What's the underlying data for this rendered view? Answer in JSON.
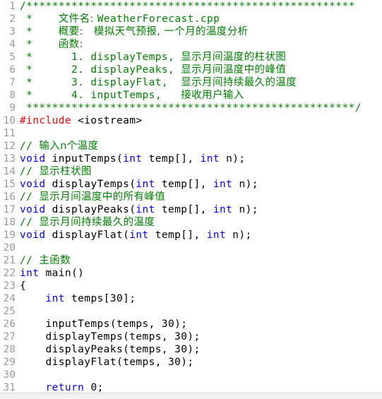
{
  "editor": {
    "name": "code-editor",
    "language": "cpp",
    "first_line": 1,
    "last_line": 31,
    "colors": {
      "background": "#ffffff",
      "gutter_text": "#9a9a9a",
      "comment": "#008000",
      "preprocessor": "#ff0000",
      "keyword": "#0000ff",
      "plain": "#000000",
      "status_strip": "#f0f0f0"
    }
  },
  "lines": [
    {
      "num": "1",
      "tokens": [
        {
          "c": "comment",
          "t": "/***************************************************"
        }
      ]
    },
    {
      "num": "2",
      "tokens": [
        {
          "c": "comment",
          "t": " *    "
        },
        {
          "c": "comment",
          "t": "文件名: ",
          "cjk": true
        },
        {
          "c": "comment",
          "t": "WeatherForecast.cpp"
        }
      ]
    },
    {
      "num": "3",
      "tokens": [
        {
          "c": "comment",
          "t": " *    "
        },
        {
          "c": "comment",
          "t": "概要:   模拟天气预报, 一个月的温度分析",
          "cjk": true
        }
      ]
    },
    {
      "num": "4",
      "tokens": [
        {
          "c": "comment",
          "t": " *    "
        },
        {
          "c": "comment",
          "t": "函数:",
          "cjk": true
        }
      ]
    },
    {
      "num": "5",
      "tokens": [
        {
          "c": "comment",
          "t": " *      1. displayTemps, "
        },
        {
          "c": "comment",
          "t": "显示月间温度的柱状图",
          "cjk": true
        }
      ]
    },
    {
      "num": "6",
      "tokens": [
        {
          "c": "comment",
          "t": " *      2. displayPeaks, "
        },
        {
          "c": "comment",
          "t": "显示月间温度中的峰值",
          "cjk": true
        }
      ]
    },
    {
      "num": "7",
      "tokens": [
        {
          "c": "comment",
          "t": " *      3. displayFlat,  "
        },
        {
          "c": "comment",
          "t": "显示月间持续最久的温度",
          "cjk": true
        }
      ]
    },
    {
      "num": "8",
      "tokens": [
        {
          "c": "comment",
          "t": " *      4. inputTemps,   "
        },
        {
          "c": "comment",
          "t": "接收用户输入",
          "cjk": true
        }
      ]
    },
    {
      "num": "9",
      "tokens": [
        {
          "c": "comment",
          "t": " ***************************************************/"
        }
      ]
    },
    {
      "num": "10",
      "tokens": [
        {
          "c": "pre",
          "t": "#include"
        },
        {
          "c": "plain",
          "t": " <iostream>"
        }
      ]
    },
    {
      "num": "11",
      "tokens": []
    },
    {
      "num": "12",
      "tokens": [
        {
          "c": "comment",
          "t": "// "
        },
        {
          "c": "comment",
          "t": "输入n个温度",
          "cjk": true
        }
      ]
    },
    {
      "num": "13",
      "tokens": [
        {
          "c": "key",
          "t": "void"
        },
        {
          "c": "plain",
          "t": " inputTemps("
        },
        {
          "c": "key",
          "t": "int"
        },
        {
          "c": "plain",
          "t": " temp[], "
        },
        {
          "c": "key",
          "t": "int"
        },
        {
          "c": "plain",
          "t": " n);"
        }
      ]
    },
    {
      "num": "14",
      "tokens": [
        {
          "c": "comment",
          "t": "// "
        },
        {
          "c": "comment",
          "t": "显示柱状图",
          "cjk": true
        }
      ]
    },
    {
      "num": "15",
      "tokens": [
        {
          "c": "key",
          "t": "void"
        },
        {
          "c": "plain",
          "t": " displayTemps("
        },
        {
          "c": "key",
          "t": "int"
        },
        {
          "c": "plain",
          "t": " temp[], "
        },
        {
          "c": "key",
          "t": "int"
        },
        {
          "c": "plain",
          "t": " n);"
        }
      ]
    },
    {
      "num": "16",
      "tokens": [
        {
          "c": "comment",
          "t": "// "
        },
        {
          "c": "comment",
          "t": "显示月间温度中的所有峰值",
          "cjk": true
        }
      ]
    },
    {
      "num": "17",
      "tokens": [
        {
          "c": "key",
          "t": "void"
        },
        {
          "c": "plain",
          "t": " displayPeaks("
        },
        {
          "c": "key",
          "t": "int"
        },
        {
          "c": "plain",
          "t": " temp[], "
        },
        {
          "c": "key",
          "t": "int"
        },
        {
          "c": "plain",
          "t": " n);"
        }
      ]
    },
    {
      "num": "18",
      "tokens": [
        {
          "c": "comment",
          "t": "// "
        },
        {
          "c": "comment",
          "t": "显示月间持续最久的温度",
          "cjk": true
        }
      ]
    },
    {
      "num": "19",
      "tokens": [
        {
          "c": "key",
          "t": "void"
        },
        {
          "c": "plain",
          "t": " displayFlat("
        },
        {
          "c": "key",
          "t": "int"
        },
        {
          "c": "plain",
          "t": " temp[], "
        },
        {
          "c": "key",
          "t": "int"
        },
        {
          "c": "plain",
          "t": " n);"
        }
      ]
    },
    {
      "num": "20",
      "tokens": []
    },
    {
      "num": "21",
      "tokens": [
        {
          "c": "comment",
          "t": "// "
        },
        {
          "c": "comment",
          "t": "主函数",
          "cjk": true
        }
      ]
    },
    {
      "num": "22",
      "tokens": [
        {
          "c": "key",
          "t": "int"
        },
        {
          "c": "plain",
          "t": " main()"
        }
      ]
    },
    {
      "num": "23",
      "tokens": [
        {
          "c": "plain",
          "t": "{"
        }
      ]
    },
    {
      "num": "24",
      "tokens": [
        {
          "c": "plain",
          "t": "    "
        },
        {
          "c": "key",
          "t": "int"
        },
        {
          "c": "plain",
          "t": " temps[30];"
        }
      ]
    },
    {
      "num": "25",
      "tokens": []
    },
    {
      "num": "26",
      "tokens": [
        {
          "c": "plain",
          "t": "    inputTemps(temps, 30);"
        }
      ]
    },
    {
      "num": "27",
      "tokens": [
        {
          "c": "plain",
          "t": "    displayTemps(temps, 30);"
        }
      ]
    },
    {
      "num": "28",
      "tokens": [
        {
          "c": "plain",
          "t": "    displayPeaks(temps, 30);"
        }
      ]
    },
    {
      "num": "29",
      "tokens": [
        {
          "c": "plain",
          "t": "    displayFlat(temps, 30);"
        }
      ]
    },
    {
      "num": "30",
      "tokens": []
    },
    {
      "num": "31",
      "tokens": [
        {
          "c": "plain",
          "t": "    "
        },
        {
          "c": "key",
          "t": "return"
        },
        {
          "c": "plain",
          "t": " 0;"
        }
      ]
    }
  ]
}
